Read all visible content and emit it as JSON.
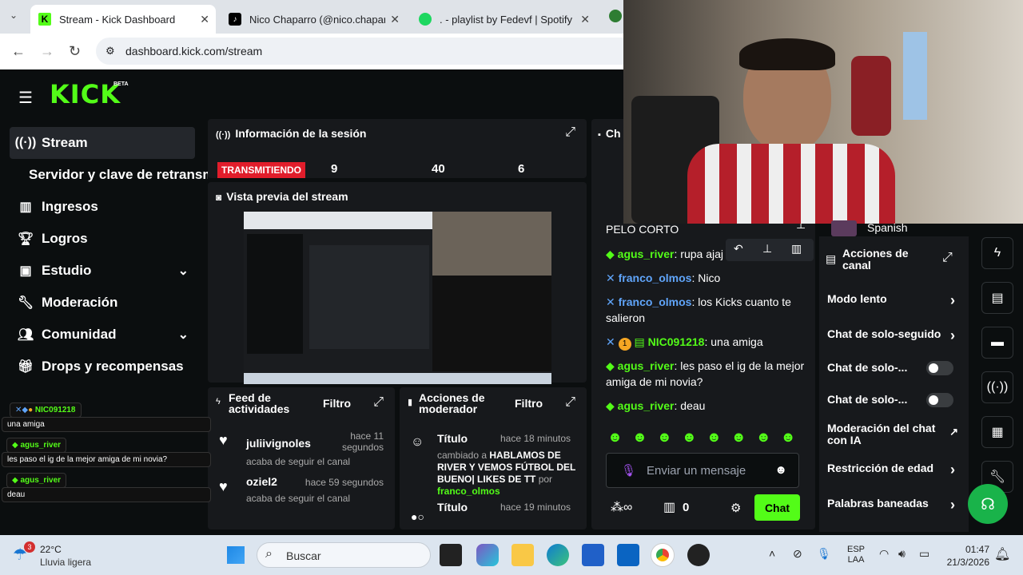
{
  "browser": {
    "tabs": [
      {
        "title": "Stream - Kick Dashboard"
      },
      {
        "title": "Nico Chaparro (@nico.chaparro"
      },
      {
        "title": ". - playlist by Fedevf | Spotify"
      }
    ],
    "url": "dashboard.kick.com/stream"
  },
  "kick": {
    "logo": "KICK",
    "beta": "BETA",
    "sidebar": [
      {
        "label": "Stream",
        "icon": "broadcast-icon"
      },
      {
        "label": "Servidor y clave de retransm"
      },
      {
        "label": "Ingresos",
        "icon": "chart-icon"
      },
      {
        "label": "Logros",
        "icon": "trophy-icon"
      },
      {
        "label": "Estudio",
        "icon": "studio-icon"
      },
      {
        "label": "Moderación",
        "icon": "wrench-icon"
      },
      {
        "label": "Comunidad",
        "icon": "people-icon"
      },
      {
        "label": "Drops y recompensas",
        "icon": "gift-icon"
      }
    ],
    "session": {
      "title": "Información de la sesión",
      "live": "TRANSMITIENDO",
      "stats": [
        "9",
        "40",
        "6"
      ]
    },
    "preview": {
      "title": "Vista previa del stream"
    },
    "activity": {
      "title": "Feed de actividades",
      "filter": "Filtro",
      "items": [
        {
          "user": "juliivignoles",
          "time": "hace 11 segundos",
          "action": "acaba de seguir el canal"
        },
        {
          "user": "oziel2",
          "time": "hace 59 segundos",
          "action": "acaba de seguir el canal"
        }
      ]
    },
    "modactions": {
      "title": "Acciones de moderador",
      "filter": "Filtro",
      "items": [
        {
          "label": "Título",
          "time": "hace 18 minutos",
          "pre": "cambiado a ",
          "bold": "HABLAMOS DE RIVER Y VEMOS FÚTBOL DEL BUENO| LIKES DE TT",
          "by": " por ",
          "user": "franco_olmos"
        },
        {
          "label": "Título",
          "time": "hace 19 minutos"
        }
      ]
    },
    "chat": {
      "header": "Ch",
      "partial_top": "PELO CORTO",
      "messages": [
        {
          "user": "agus_river",
          "text": ": rupa ajaj"
        },
        {
          "user": "franco_olmos",
          "text": ": Nico"
        },
        {
          "user": "franco_olmos",
          "text": ": los Kicks cuanto te salieron"
        },
        {
          "user": "NIC091218",
          "badge": "1",
          "text": ": una amiga"
        },
        {
          "user": "agus_river",
          "text": ": les paso el ig de la mejor amiga de mi novia?"
        },
        {
          "user": "agus_river",
          "text": ": deau"
        }
      ],
      "placeholder": "Enviar un mensaje",
      "points": "0",
      "send": "Chat"
    },
    "lang": "Spanish",
    "channel_actions": {
      "title": "Acciones de canal",
      "items": [
        {
          "label": "Modo lento",
          "type": "chevron"
        },
        {
          "label": "Chat de solo-seguido",
          "type": "chevron"
        },
        {
          "label": "Chat de solo-...",
          "type": "toggle"
        },
        {
          "label": "Chat de solo-...",
          "type": "toggle"
        },
        {
          "label": "Moderación del chat con IA",
          "type": "external"
        },
        {
          "label": "Restricción de edad",
          "type": "chevron"
        },
        {
          "label": "Palabras baneadas",
          "type": "chevron"
        }
      ]
    }
  },
  "overlay": [
    {
      "user": "NIC091218",
      "text": "una amiga"
    },
    {
      "user": "agus_river",
      "text": "les paso el ig de la mejor amiga de mi novia?"
    },
    {
      "user": "agus_river",
      "text": "deau"
    }
  ],
  "taskbar": {
    "weather_temp": "22°C",
    "weather_desc": "Lluvia ligera",
    "weather_badge": "3",
    "search": "Buscar",
    "lang1": "ESP",
    "lang2": "LAA",
    "time": "01:47",
    "date": "21/3/2026"
  },
  "colors": {
    "kick_green": "#53fc18",
    "live_red": "#e11d2b",
    "bg": "#0b0e0f",
    "panel": "#17191c"
  }
}
